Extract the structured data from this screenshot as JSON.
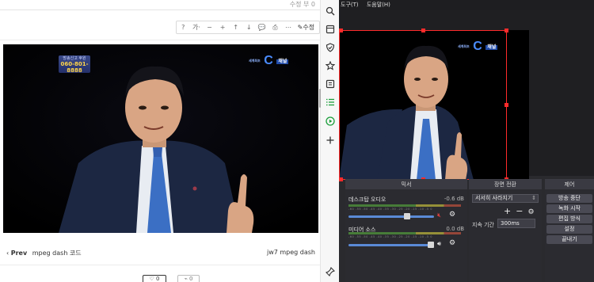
{
  "blog": {
    "read_count": "수정 부 0",
    "toolbar": {
      "item_question": "?",
      "item_font": "가·",
      "item_zoom_out": "−",
      "item_zoom_in": "+",
      "item_up": "↑",
      "item_down": "↓",
      "item_comment": "💬",
      "item_print": "⎙",
      "item_more": "⋯",
      "edit_label": "✎수정"
    },
    "video": {
      "logo_small": "방송신고 후원",
      "logo_phone": "060-801-8888",
      "channel_logo_prefix": "세계최초",
      "channel_logo_main": "C",
      "channel_logo_tag": "채널"
    },
    "nav": {
      "prev_arrow": "‹",
      "prev_label": "Prev",
      "prev_title": "mpeg dash 코드",
      "next_title": "jw7 mpeg dash"
    },
    "like_count": "♡ 0",
    "share_count": "⌁ 0"
  },
  "sidebar": {
    "icons": [
      "search-icon",
      "page-icon",
      "shield-icon",
      "star-icon",
      "collection-icon",
      "play-icon",
      "add-icon",
      "pin-icon"
    ]
  },
  "obs": {
    "menu": [
      "도구(T)",
      "도움말(H)"
    ],
    "mixer": {
      "title": "믹서",
      "tracks": [
        {
          "name": "데스크탑 오디오",
          "db": "-0.6 dB",
          "ticks": "-60 -55 -50 -45 -40 -35 -30 -25 -20 -15 -10 -5 0"
        },
        {
          "name": "미디어 소스",
          "db": "0.0 dB",
          "ticks": "-60 -55 -50 -45 -40 -35 -30 -25 -20 -15 -10 -5 0"
        }
      ]
    },
    "transition": {
      "title": "장면 전환",
      "combo_value": "서서히 사라지기",
      "duration_label": "지속 기간",
      "duration_value": "300ms"
    },
    "controls": {
      "title": "제어",
      "buttons": [
        "방송 중단",
        "녹화 시작",
        "편집 방식",
        "설정",
        "끝내기"
      ]
    },
    "scene_logo_prefix": "세계최초",
    "scene_logo_main": "C",
    "scene_logo_tag": "채널"
  },
  "colors": {
    "selection_red": "#ff2b2b",
    "obs_bg": "#2a2a2e",
    "slider_blue": "#5a8ad6"
  }
}
